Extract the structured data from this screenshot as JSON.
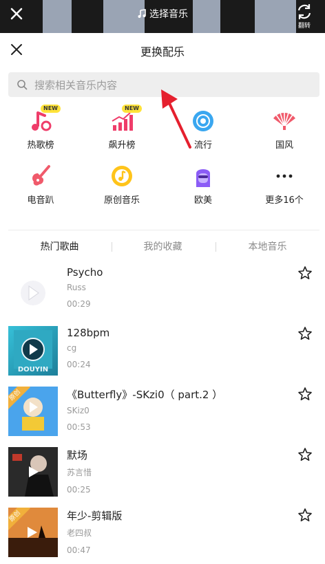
{
  "topbar": {
    "title": "选择音乐",
    "flip_label": "翻转"
  },
  "header": {
    "title": "更换配乐"
  },
  "search": {
    "placeholder": "搜索相关音乐内容"
  },
  "categories": [
    {
      "label": "热歌榜",
      "icon": "hot-songs-icon",
      "new": "NEW",
      "color": "#ef3d6a"
    },
    {
      "label": "飙升榜",
      "icon": "rising-chart-icon",
      "new": "NEW",
      "color": "#ef3d6a"
    },
    {
      "label": "流行",
      "icon": "pop-disc-icon",
      "color": "#3aa7f0"
    },
    {
      "label": "国风",
      "icon": "folding-fan-icon",
      "color": "#f05a6b"
    },
    {
      "label": "电音趴",
      "icon": "electric-guitar-icon",
      "color": "#f05a6b"
    },
    {
      "label": "原创音乐",
      "icon": "original-music-icon",
      "color": "#ffc41a"
    },
    {
      "label": "欧美",
      "icon": "western-avatar-icon",
      "color": "#8b5cf6"
    },
    {
      "label": "更多16个",
      "icon": "more-dots-icon",
      "color": "#222222"
    }
  ],
  "tabs": [
    {
      "label": "热门歌曲",
      "active": true
    },
    {
      "label": "我的收藏",
      "active": false
    },
    {
      "label": "本地音乐",
      "active": false
    }
  ],
  "songs": [
    {
      "title": "Psycho",
      "artist": "Russ",
      "duration": "00:29",
      "original": ""
    },
    {
      "title": "128bpm",
      "artist": "cg",
      "duration": "00:24",
      "original": "",
      "cover_text": "DOUYIN"
    },
    {
      "title": "《Butterfly》-SKzi0（ part.2 ）",
      "artist": "SKiz0",
      "duration": "00:53",
      "original": "原创"
    },
    {
      "title": "默场",
      "artist": "苏言惜",
      "duration": "00:25",
      "original": ""
    },
    {
      "title": "年少-剪辑版",
      "artist": "老四叔",
      "duration": "00:47",
      "original": "原创"
    }
  ]
}
